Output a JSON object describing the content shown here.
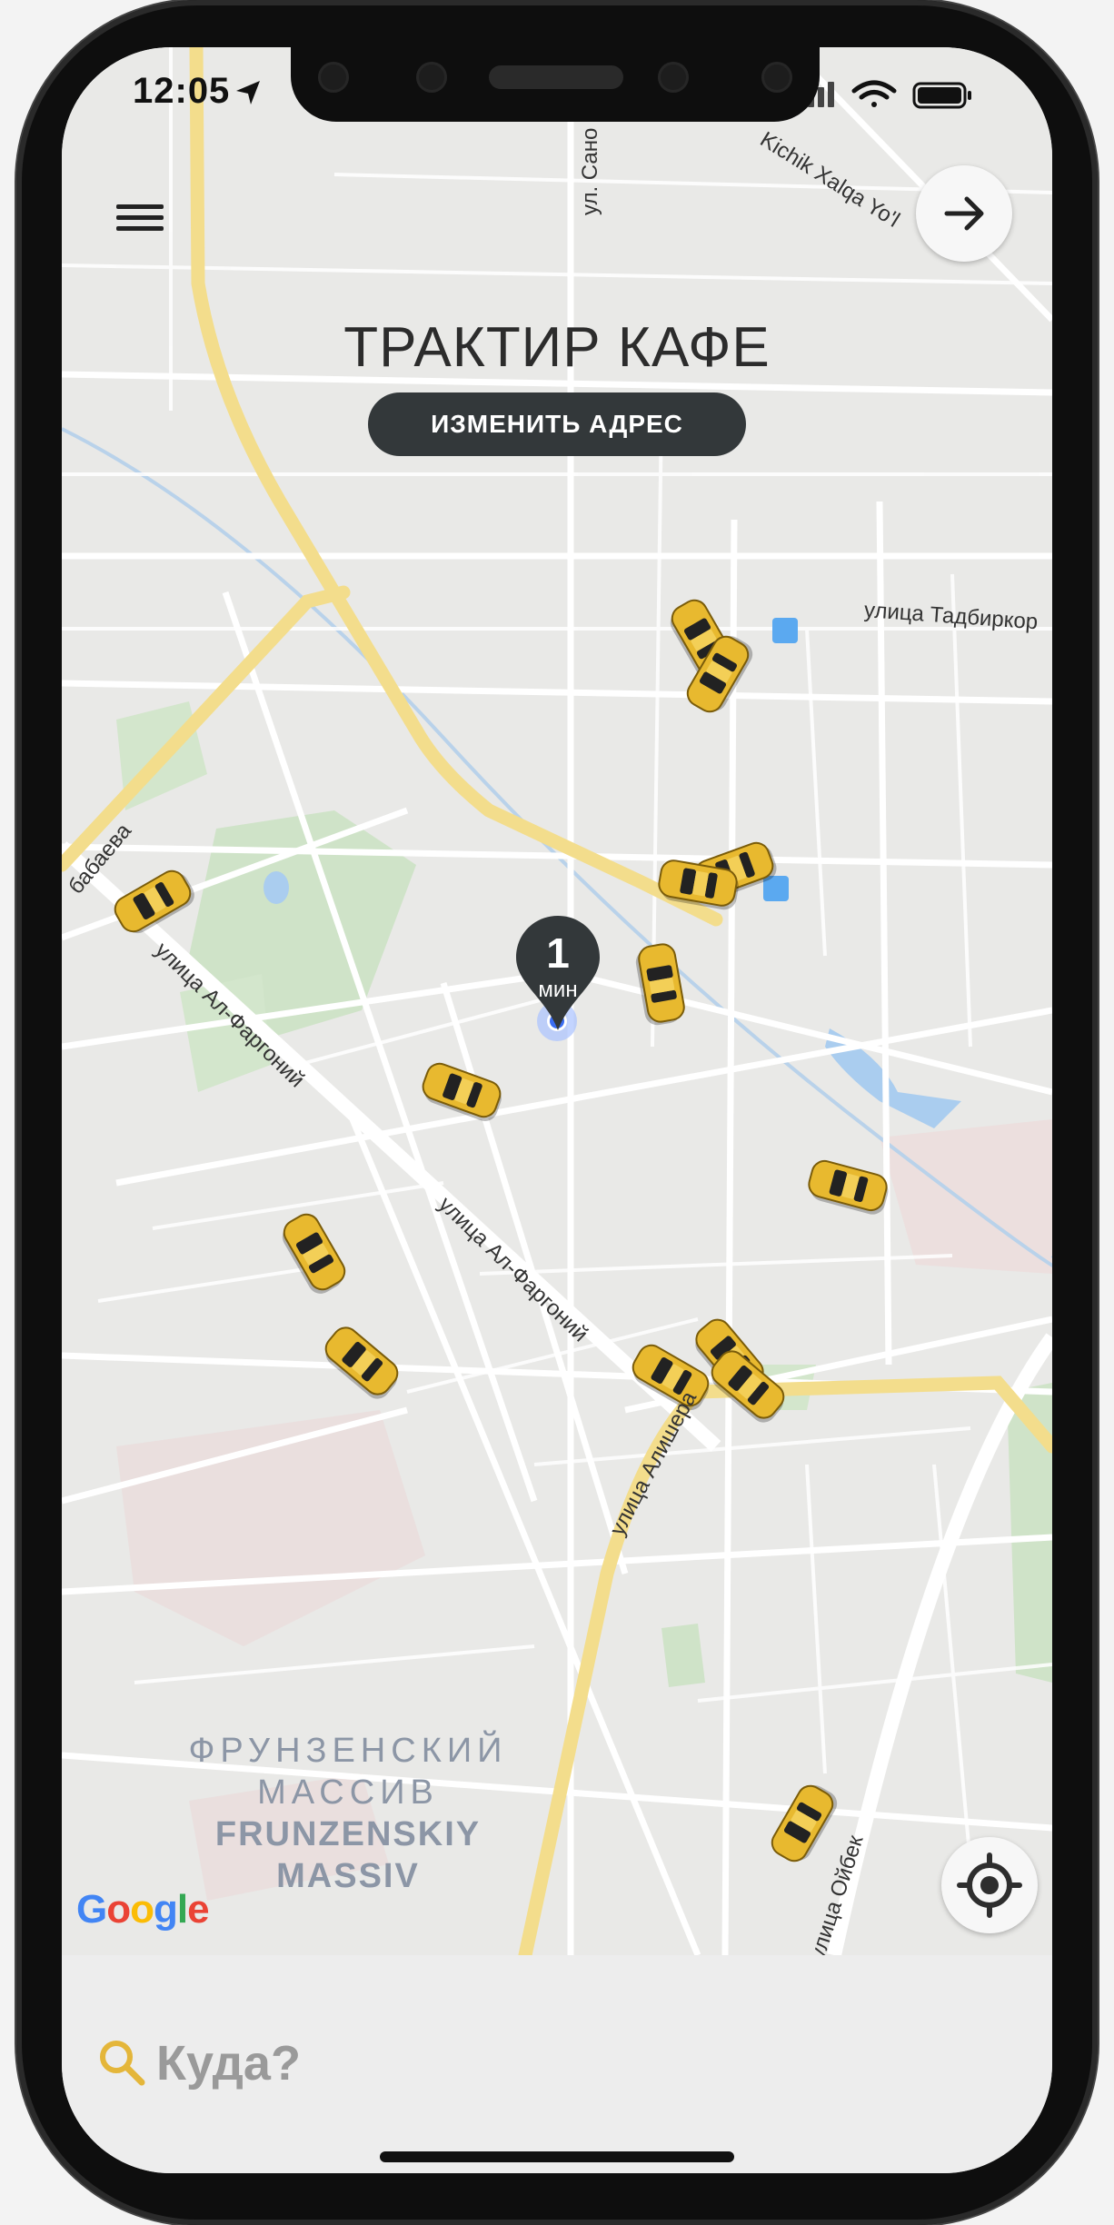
{
  "status_bar": {
    "time": "12:05"
  },
  "header": {
    "title": "ТРАКТИР КАФЕ",
    "change_address_label": "ИЗМЕНИТЬ АДРЕС"
  },
  "map": {
    "eta_value": "1",
    "eta_unit": "мин",
    "streets": {
      "sanoat": "ул. Сано",
      "kichik": "Kichik Xalqa Yo'l",
      "tadbirkor": "улица Тадбиркор",
      "babaeva": "бабаева",
      "alfargoniy_1": "улица Ал-Фаргоний",
      "alfargoniy_2": "улица Ал-Фаргоний",
      "alishera": "улица Алишера",
      "oybek": "улица Ойбек"
    },
    "district": {
      "line1": "ФРУНЗЕНСКИЙ",
      "line2": "МАССИВ",
      "line3": "FRUNZENSKIY",
      "line4": "MASSIV"
    },
    "attribution": "Google",
    "cars_count": 14
  },
  "search": {
    "placeholder": "Куда?"
  },
  "colors": {
    "accent": "#e4b63a",
    "dark": "#33383a",
    "road_major": "#f3dd8c",
    "map_bg": "#e9e9e7"
  },
  "icons": {
    "menu": "hamburger-icon",
    "next": "arrow-right-icon",
    "locate": "crosshair-icon",
    "search": "search-icon"
  }
}
